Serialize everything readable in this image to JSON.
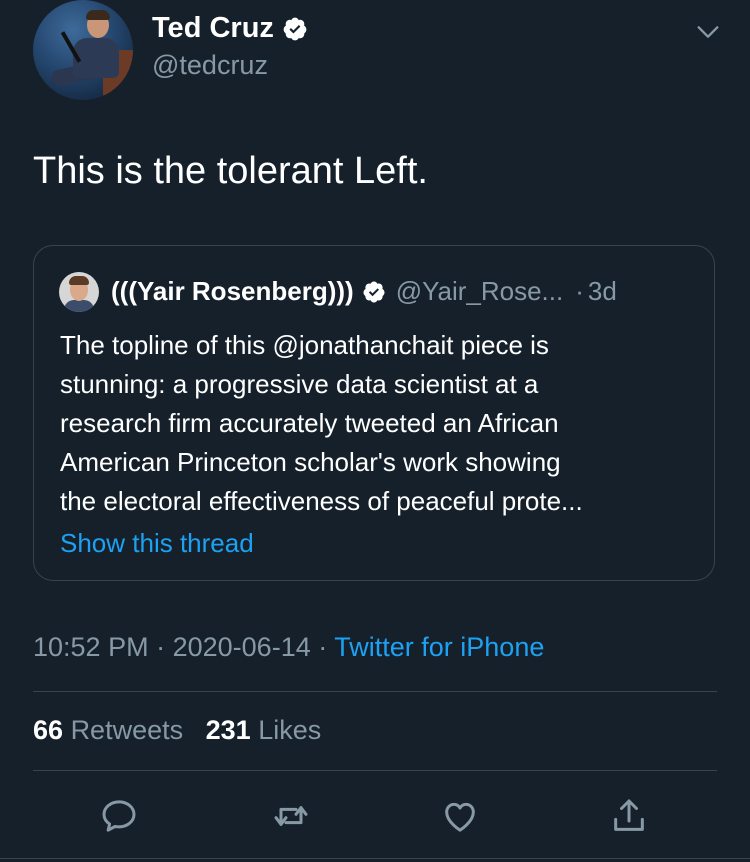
{
  "author": {
    "display_name": "Ted Cruz",
    "handle": "@tedcruz"
  },
  "tweet": {
    "text": "This is the tolerant Left."
  },
  "quoted": {
    "display_name": "(((Yair Rosenberg)))",
    "handle": "@Yair_Rose...",
    "separator": "·",
    "time": "3d",
    "body_lines": [
      "The topline of this @jonathanchait piece is",
      "stunning: a progressive data scientist at a",
      "research firm accurately tweeted an African",
      "American Princeton scholar's work showing",
      "the electoral effectiveness of peaceful prote..."
    ],
    "show_thread": "Show this thread"
  },
  "meta": {
    "time": "10:52 PM",
    "sep1": "·",
    "date": "2020-06-14",
    "sep2": "·",
    "source": "Twitter for iPhone"
  },
  "stats": {
    "retweets_count": "66",
    "retweets_label": "Retweets",
    "likes_count": "231",
    "likes_label": "Likes"
  },
  "icons": {
    "caret": "chevron-down-icon",
    "verified": "verified-badge-icon",
    "reply": "reply-icon",
    "retweet": "retweet-icon",
    "like": "heart-icon",
    "share": "share-icon"
  },
  "colors": {
    "background": "#15202b",
    "text": "#ffffff",
    "secondary": "#8899a6",
    "accent": "#1da1f2",
    "border": "#38444d"
  }
}
